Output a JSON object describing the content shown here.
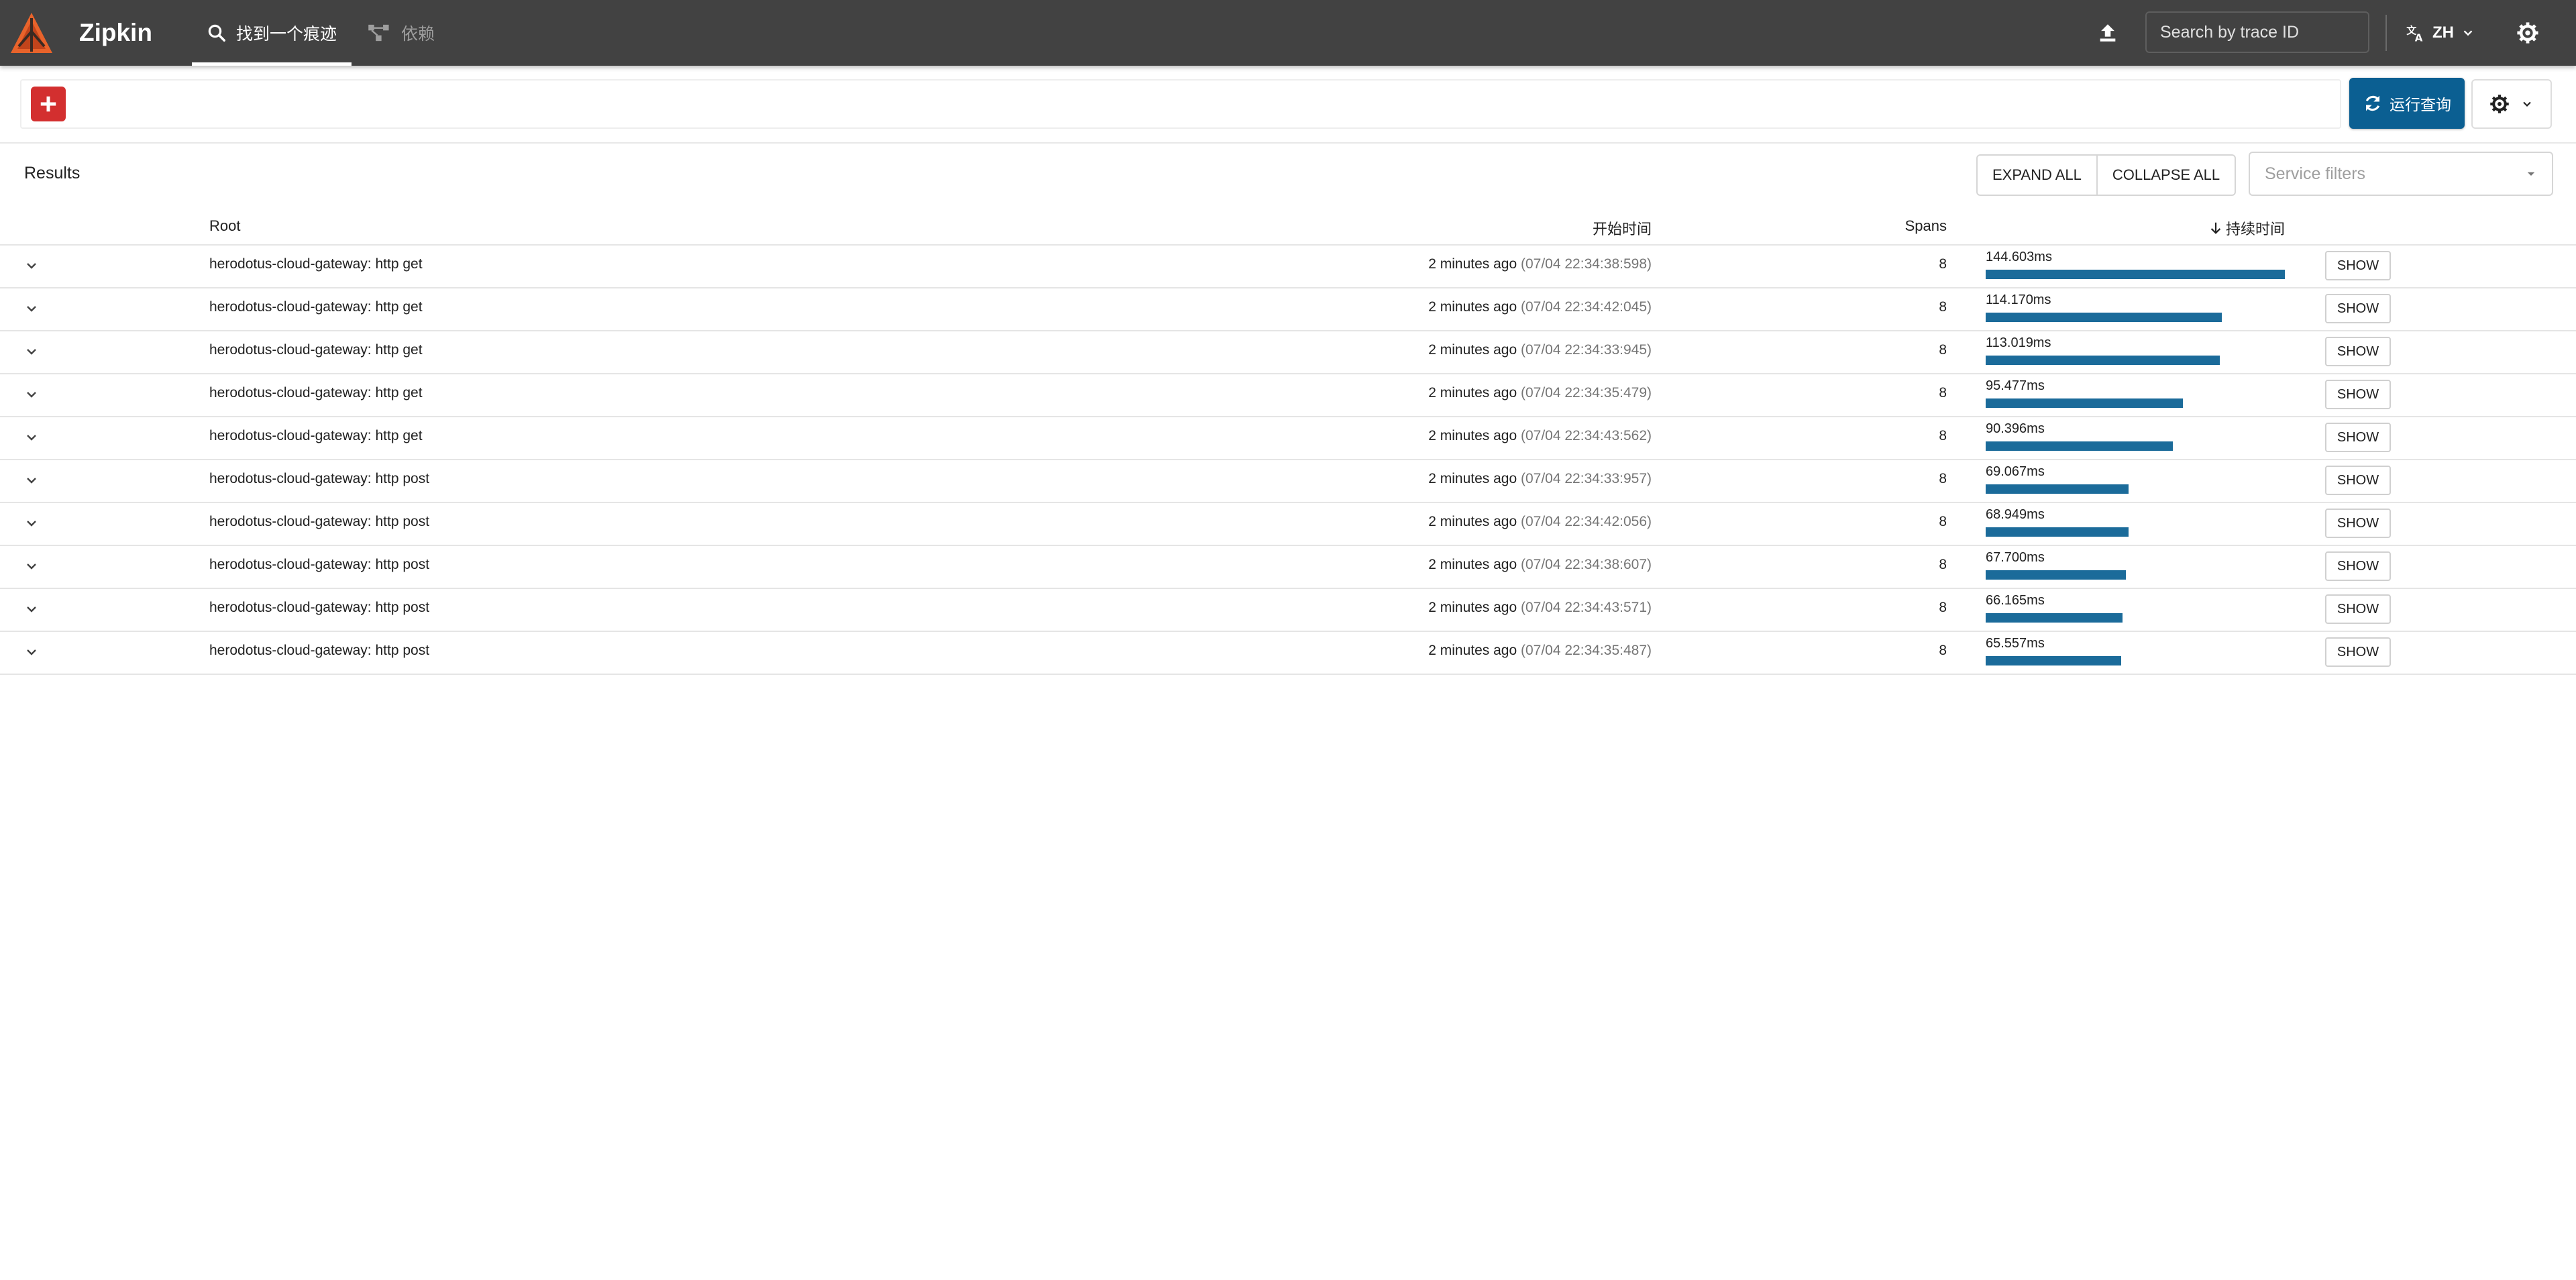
{
  "app": {
    "title": "Zipkin",
    "accent": "#e8632b",
    "bar_color": "#424242"
  },
  "nav": {
    "tabs": [
      {
        "label": "找到一个痕迹",
        "icon": "search-icon",
        "active": true
      },
      {
        "label": "依赖",
        "icon": "dependency-icon",
        "active": false
      }
    ]
  },
  "topbar": {
    "search_placeholder": "Search by trace ID",
    "language": "ZH",
    "icons": [
      "upload-icon",
      "translate-icon",
      "chevron-down-icon",
      "settings-icon"
    ]
  },
  "query": {
    "add_icon": "plus-icon",
    "run_label": "运行查询",
    "run_icon": "refresh-icon",
    "settings_icon": "gear-icon",
    "run_color": "#0b5f92"
  },
  "results": {
    "title": "Results",
    "expand_all": "EXPAND ALL",
    "collapse_all": "COLLAPSE ALL",
    "service_filter_placeholder": "Service filters",
    "columns": {
      "root": "Root",
      "start": "开始时间",
      "spans": "Spans",
      "duration": "持续时间"
    },
    "sort_icon": "arrow-down-icon",
    "bar_color": "#1b6b9a",
    "max_duration_ms": 144.603,
    "rows": [
      {
        "root": "herodotus-cloud-gateway: http get",
        "ago": "2 minutes ago",
        "time": "(07/04 22:34:38:598)",
        "spans": "8",
        "duration": "144.603ms",
        "duration_ms": 144.603,
        "show": "SHOW"
      },
      {
        "root": "herodotus-cloud-gateway: http get",
        "ago": "2 minutes ago",
        "time": "(07/04 22:34:42:045)",
        "spans": "8",
        "duration": "114.170ms",
        "duration_ms": 114.17,
        "show": "SHOW"
      },
      {
        "root": "herodotus-cloud-gateway: http get",
        "ago": "2 minutes ago",
        "time": "(07/04 22:34:33:945)",
        "spans": "8",
        "duration": "113.019ms",
        "duration_ms": 113.019,
        "show": "SHOW"
      },
      {
        "root": "herodotus-cloud-gateway: http get",
        "ago": "2 minutes ago",
        "time": "(07/04 22:34:35:479)",
        "spans": "8",
        "duration": "95.477ms",
        "duration_ms": 95.477,
        "show": "SHOW"
      },
      {
        "root": "herodotus-cloud-gateway: http get",
        "ago": "2 minutes ago",
        "time": "(07/04 22:34:43:562)",
        "spans": "8",
        "duration": "90.396ms",
        "duration_ms": 90.396,
        "show": "SHOW"
      },
      {
        "root": "herodotus-cloud-gateway: http post",
        "ago": "2 minutes ago",
        "time": "(07/04 22:34:33:957)",
        "spans": "8",
        "duration": "69.067ms",
        "duration_ms": 69.067,
        "show": "SHOW"
      },
      {
        "root": "herodotus-cloud-gateway: http post",
        "ago": "2 minutes ago",
        "time": "(07/04 22:34:42:056)",
        "spans": "8",
        "duration": "68.949ms",
        "duration_ms": 68.949,
        "show": "SHOW"
      },
      {
        "root": "herodotus-cloud-gateway: http post",
        "ago": "2 minutes ago",
        "time": "(07/04 22:34:38:607)",
        "spans": "8",
        "duration": "67.700ms",
        "duration_ms": 67.7,
        "show": "SHOW"
      },
      {
        "root": "herodotus-cloud-gateway: http post",
        "ago": "2 minutes ago",
        "time": "(07/04 22:34:43:571)",
        "spans": "8",
        "duration": "66.165ms",
        "duration_ms": 66.165,
        "show": "SHOW"
      },
      {
        "root": "herodotus-cloud-gateway: http post",
        "ago": "2 minutes ago",
        "time": "(07/04 22:34:35:487)",
        "spans": "8",
        "duration": "65.557ms",
        "duration_ms": 65.557,
        "show": "SHOW"
      }
    ]
  }
}
